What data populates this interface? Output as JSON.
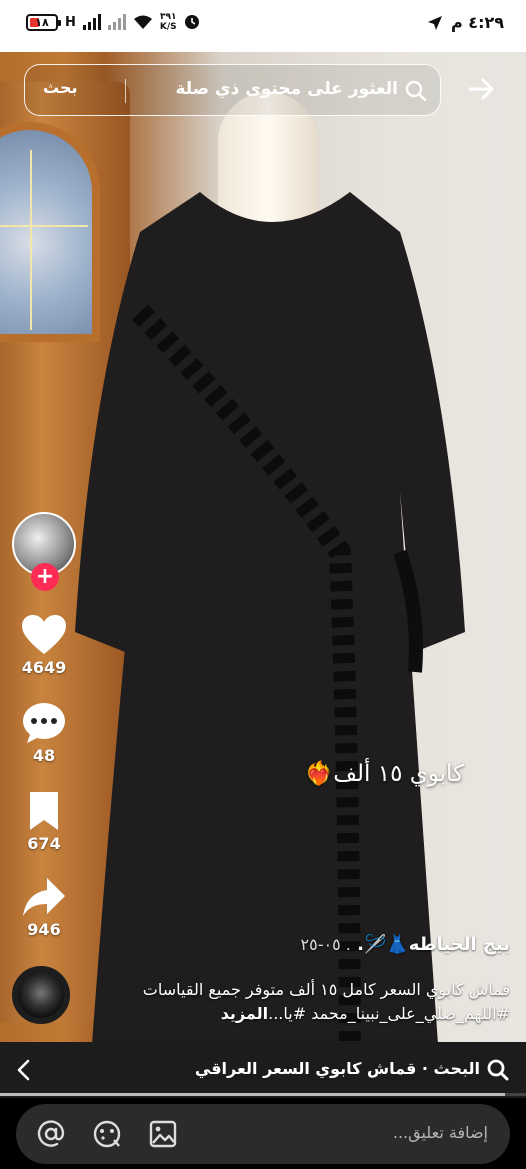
{
  "status_bar": {
    "battery": "١٨",
    "signal_label": "H",
    "speed_value": "٣٩١",
    "speed_unit": "K/S",
    "time": "٤:٢٩ م"
  },
  "search": {
    "query": "العثور على محتوى ذي صلة",
    "button_label": "بحث"
  },
  "actions": {
    "likes": "4649",
    "comments": "48",
    "saves": "674",
    "shares": "946"
  },
  "video": {
    "overlay_text": "كابوي ١٥ ألف❤️‍🔥",
    "author": "بيج الخياطه👗🪡.",
    "date": ". ٠٥-٢٥",
    "description": "قماش كابوي السعر كامل ١٥ ألف متوفر جميع القياسات #اللهم_صلي_على_نبينا_محمد #يا...",
    "more_label": "المزيد",
    "progress_fraction": 0.96
  },
  "related_search": {
    "label": "البحث · قماش كابوي السعر العراقي"
  },
  "comment": {
    "placeholder": "إضافة تعليق..."
  },
  "colors": {
    "accent": "#fe2c55",
    "battery_low": "#e8342f"
  }
}
